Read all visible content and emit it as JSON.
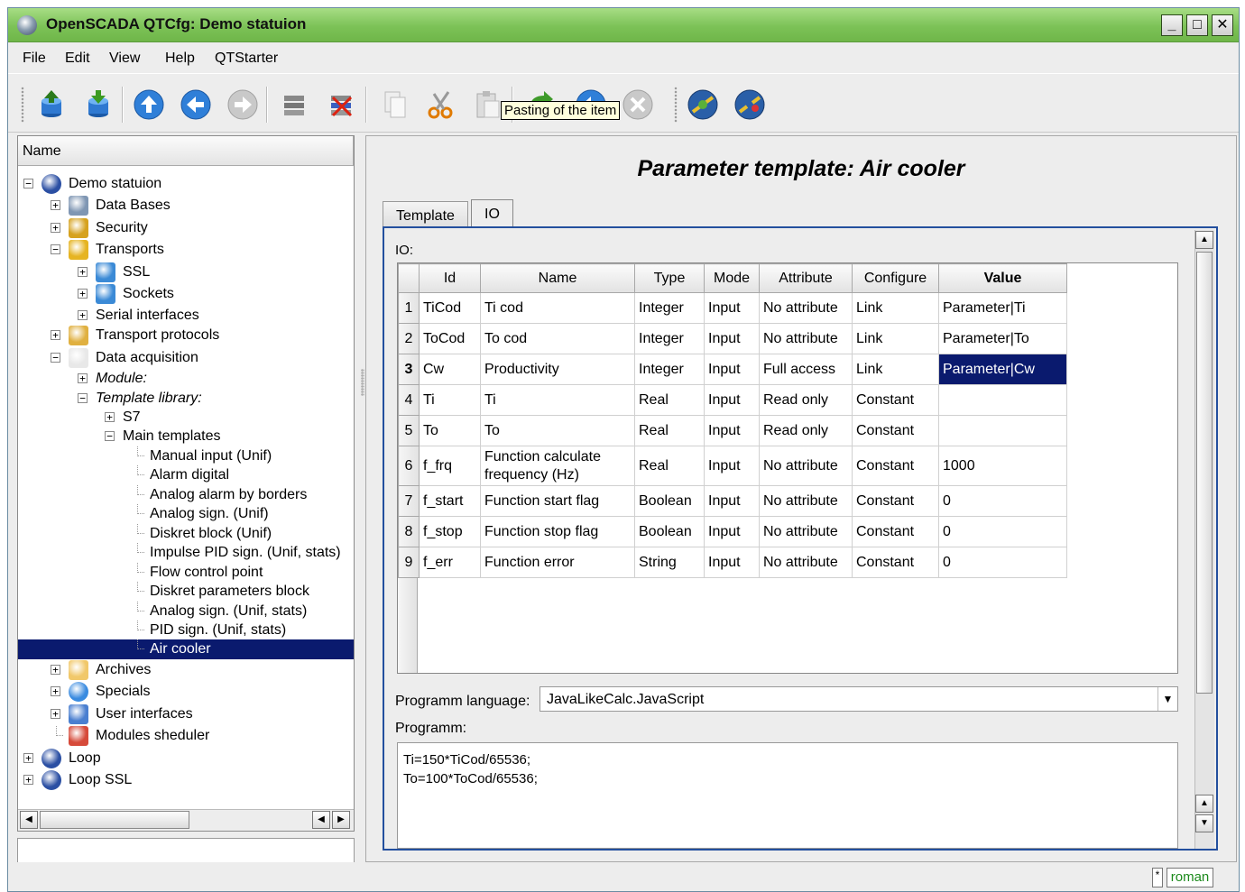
{
  "window": {
    "title": "OpenSCADA QTCfg: Demo statuion"
  },
  "menu": [
    "File",
    "Edit",
    "View",
    "Help",
    "QTStarter"
  ],
  "toolbar": {
    "tooltip": "Pasting of the item",
    "icons": [
      "db-load-icon",
      "db-save-icon",
      "up-icon",
      "back-icon",
      "forward-icon",
      "add-item-icon",
      "delete-item-icon",
      "copy-icon",
      "cut-icon",
      "paste-icon",
      "refresh-icon",
      "start-icon",
      "stop-icon",
      "connect-icon",
      "disconnect-icon"
    ]
  },
  "tree": {
    "header": "Name",
    "items": [
      {
        "label": "Demo statuion",
        "icon": "computer-icon"
      },
      {
        "label": "Data Bases",
        "icon": "database-icon"
      },
      {
        "label": "Security",
        "icon": "security-icon"
      },
      {
        "label": "Transports",
        "icon": "transport-icon"
      },
      {
        "label": "SSL",
        "icon": "ssl-icon"
      },
      {
        "label": "Sockets",
        "icon": "sockets-icon"
      },
      {
        "label": "Serial interfaces",
        "icon": ""
      },
      {
        "label": "Transport protocols",
        "icon": "protocol-icon"
      },
      {
        "label": "Data acquisition",
        "icon": "daq-icon"
      },
      {
        "label": "Module:",
        "icon": ""
      },
      {
        "label": "Template library:",
        "icon": ""
      },
      {
        "label": "S7",
        "icon": ""
      },
      {
        "label": "Main templates",
        "icon": ""
      },
      {
        "label": "Manual input (Unif)",
        "icon": ""
      },
      {
        "label": "Alarm digital",
        "icon": ""
      },
      {
        "label": "Analog alarm by borders",
        "icon": ""
      },
      {
        "label": "Analog sign. (Unif)",
        "icon": ""
      },
      {
        "label": "Diskret block (Unif)",
        "icon": ""
      },
      {
        "label": "Impulse PID sign. (Unif, stats)",
        "icon": ""
      },
      {
        "label": "Flow control point",
        "icon": ""
      },
      {
        "label": "Diskret parameters block",
        "icon": ""
      },
      {
        "label": "Analog sign. (Unif, stats)",
        "icon": ""
      },
      {
        "label": "PID sign. (Unif, stats)",
        "icon": ""
      },
      {
        "label": "Air cooler",
        "icon": ""
      },
      {
        "label": "Archives",
        "icon": "archive-icon"
      },
      {
        "label": "Specials",
        "icon": "specials-icon"
      },
      {
        "label": "User interfaces",
        "icon": "ui-icon"
      },
      {
        "label": "Modules sheduler",
        "icon": "scheduler-icon"
      },
      {
        "label": "Loop",
        "icon": "computer-icon"
      },
      {
        "label": "Loop SSL",
        "icon": "computer-icon"
      }
    ]
  },
  "page": {
    "title": "Parameter template: Air cooler",
    "tabs": [
      "Template",
      "IO"
    ],
    "io_label": "IO:",
    "table": {
      "columns": [
        "Id",
        "Name",
        "Type",
        "Mode",
        "Attribute",
        "Configure",
        "Value"
      ],
      "rows": [
        [
          "1",
          "TiCod",
          "Ti cod",
          "Integer",
          "Input",
          "No attribute",
          "Link",
          "Parameter|Ti"
        ],
        [
          "2",
          "ToCod",
          "To cod",
          "Integer",
          "Input",
          "No attribute",
          "Link",
          "Parameter|To"
        ],
        [
          "3",
          "Cw",
          "Productivity",
          "Integer",
          "Input",
          "Full access",
          "Link",
          "Parameter|Cw"
        ],
        [
          "4",
          "Ti",
          "Ti",
          "Real",
          "Input",
          "Read only",
          "Constant",
          ""
        ],
        [
          "5",
          "To",
          " To",
          "Real",
          "Input",
          "Read only",
          "Constant",
          ""
        ],
        [
          "6",
          "f_frq",
          "Function calculate frequency (Hz)",
          "Real",
          "Input",
          "No attribute",
          "Constant",
          "1000"
        ],
        [
          "7",
          "f_start",
          "Function start flag",
          "Boolean",
          "Input",
          "No attribute",
          "Constant",
          "0"
        ],
        [
          "8",
          "f_stop",
          "Function stop flag",
          "Boolean",
          "Input",
          "No attribute",
          "Constant",
          "0"
        ],
        [
          "9",
          "f_err",
          "Function error",
          "String",
          "Input",
          "No attribute",
          "Constant",
          "0"
        ]
      ]
    },
    "language_label": "Programm language:",
    "language_value": "JavaLikeCalc.JavaScript",
    "program_label": "Programm:",
    "program_lines": [
      "Ti=150*TiCod/65536;",
      "To=100*ToCod/65536;"
    ]
  },
  "status": {
    "modified": "*",
    "user": "roman"
  }
}
